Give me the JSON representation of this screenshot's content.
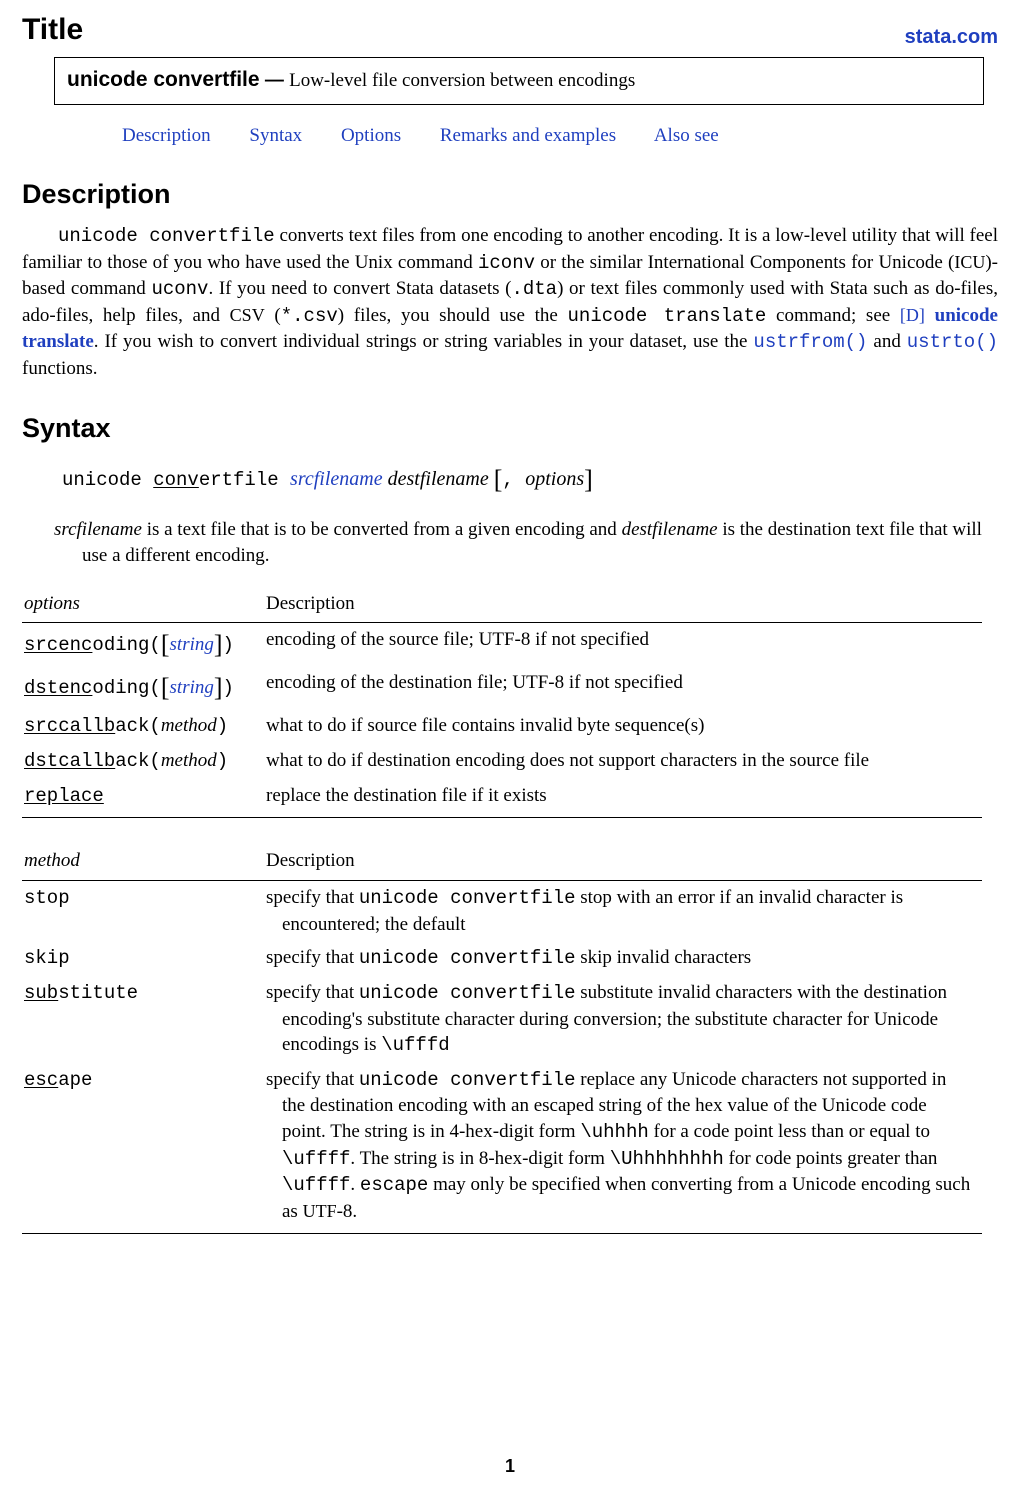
{
  "header": {
    "title": "Title",
    "brand": "stata.com",
    "command": "unicode convertfile",
    "dash": " — ",
    "subtitle": "Low-level file conversion between encodings"
  },
  "toc": {
    "description": "Description",
    "syntax": "Syntax",
    "options": "Options",
    "remarks": "Remarks and examples",
    "alsosee": "Also see"
  },
  "description": {
    "heading": "Description",
    "p1a": "unicode convertfile",
    "p1b": " converts text files from one encoding to another encoding. It is a low-level utility that will feel familiar to those of you who have used the Unix command ",
    "p1c": "iconv",
    "p1d": " or the similar International Components for Unicode (",
    "p1e": "ICU",
    "p1f": ")-based command ",
    "p1g": "uconv",
    "p1h": ". If you need to convert Stata datasets (",
    "p1i": ".dta",
    "p1j": ") or text files commonly used with Stata such as do-files, ado-files, help files, and ",
    "p1k": "CSV",
    "p1l": " (",
    "p1m": "*.csv",
    "p1n": ") files, you should use the ",
    "p1o": "unicode translate",
    "p1p": " command; see ",
    "p1q": "[D]",
    "p1r": " ",
    "p1s": "unicode translate",
    "p1t": ". If you wish to convert individual strings or string variables in your dataset, use the ",
    "p1u": "ustrfrom()",
    "p1v": " and ",
    "p1w": "ustrto()",
    "p1x": " functions."
  },
  "syntax": {
    "heading": "Syntax",
    "line": {
      "cmd1": "unicode ",
      "cmd2u": "conv",
      "cmd2r": "ertfile ",
      "src": "srcfilename",
      "dst": " destfilename ",
      "lb": "[",
      "comma": ", ",
      "opts": "options",
      "rb": "]"
    },
    "note_a": "srcfilename",
    "note_b": " is a text file that is to be converted from a given encoding and ",
    "note_c": "destfilename",
    "note_d": " is the destination text file that will use a different encoding."
  },
  "options_table": {
    "hdr_opt": "options",
    "hdr_desc": "Description",
    "rows": [
      {
        "opt_u": "srcenc",
        "opt_r": "oding(",
        "arg_lb": "[",
        "arg": "string",
        "arg_rb": "]",
        "opt_close": ")",
        "desc": "encoding of the source file; UTF-8 if not specified",
        "tt_arg": false
      },
      {
        "opt_u": "dstenc",
        "opt_r": "oding(",
        "arg_lb": "[",
        "arg": "string",
        "arg_rb": "]",
        "opt_close": ")",
        "desc": "encoding of the destination file; UTF-8 if not specified",
        "tt_arg": false
      },
      {
        "opt_u": "srccallb",
        "opt_r": "ack(",
        "arg_lb": "",
        "arg": "method",
        "arg_rb": "",
        "opt_close": ")",
        "desc": "what to do if source file contains invalid byte sequence(s)",
        "tt_arg": false
      },
      {
        "opt_u": "dstcallb",
        "opt_r": "ack(",
        "arg_lb": "",
        "arg": "method",
        "arg_rb": "",
        "opt_close": ")",
        "desc": "what to do if destination encoding does not support characters in the source file",
        "tt_arg": false
      },
      {
        "opt_u": "replace",
        "opt_r": "",
        "arg_lb": "",
        "arg": "",
        "arg_rb": "",
        "opt_close": "",
        "desc": "replace the destination file if it exists",
        "tt_arg": false
      }
    ]
  },
  "method_table": {
    "hdr_opt": "method",
    "hdr_desc": "Description",
    "rows": {
      "stop": {
        "opt": "stop",
        "d1": "specify that ",
        "d2": "unicode convertfile",
        "d3": " stop with an error if an invalid character is encountered; the default"
      },
      "skip": {
        "opt": "skip",
        "d1": "specify that ",
        "d2": "unicode convertfile",
        "d3": " skip invalid characters"
      },
      "sub": {
        "opt_u": "sub",
        "opt_r": "stitute",
        "d1": "specify that ",
        "d2": "unicode convertfile",
        "d3": " substitute invalid characters with the destination encoding's substitute character during conversion; the substitute character for Unicode encodings is ",
        "d4": "\\ufffd"
      },
      "esc": {
        "opt_u": "esc",
        "opt_r": "ape",
        "d1": "specify that ",
        "d2": "unicode convertfile",
        "d3": " replace any Unicode characters not supported in the destination encoding with an escaped string of the hex value of the Unicode code point. The string is in 4-hex-digit form ",
        "d4": "\\uhhhh",
        "d5": " for a code point less than or equal to ",
        "d6": "\\uffff",
        "d7": ". The string is in 8-hex-digit form ",
        "d8": "\\Uhhhhhhhh",
        "d9": " for code points greater than ",
        "d10": "\\uffff",
        "d11": ". ",
        "d12": "escape",
        "d13": " may only be specified when converting from a Unicode encoding such as ",
        "d14": "UTF",
        "d15": "-8."
      }
    }
  },
  "pagenum": "1"
}
